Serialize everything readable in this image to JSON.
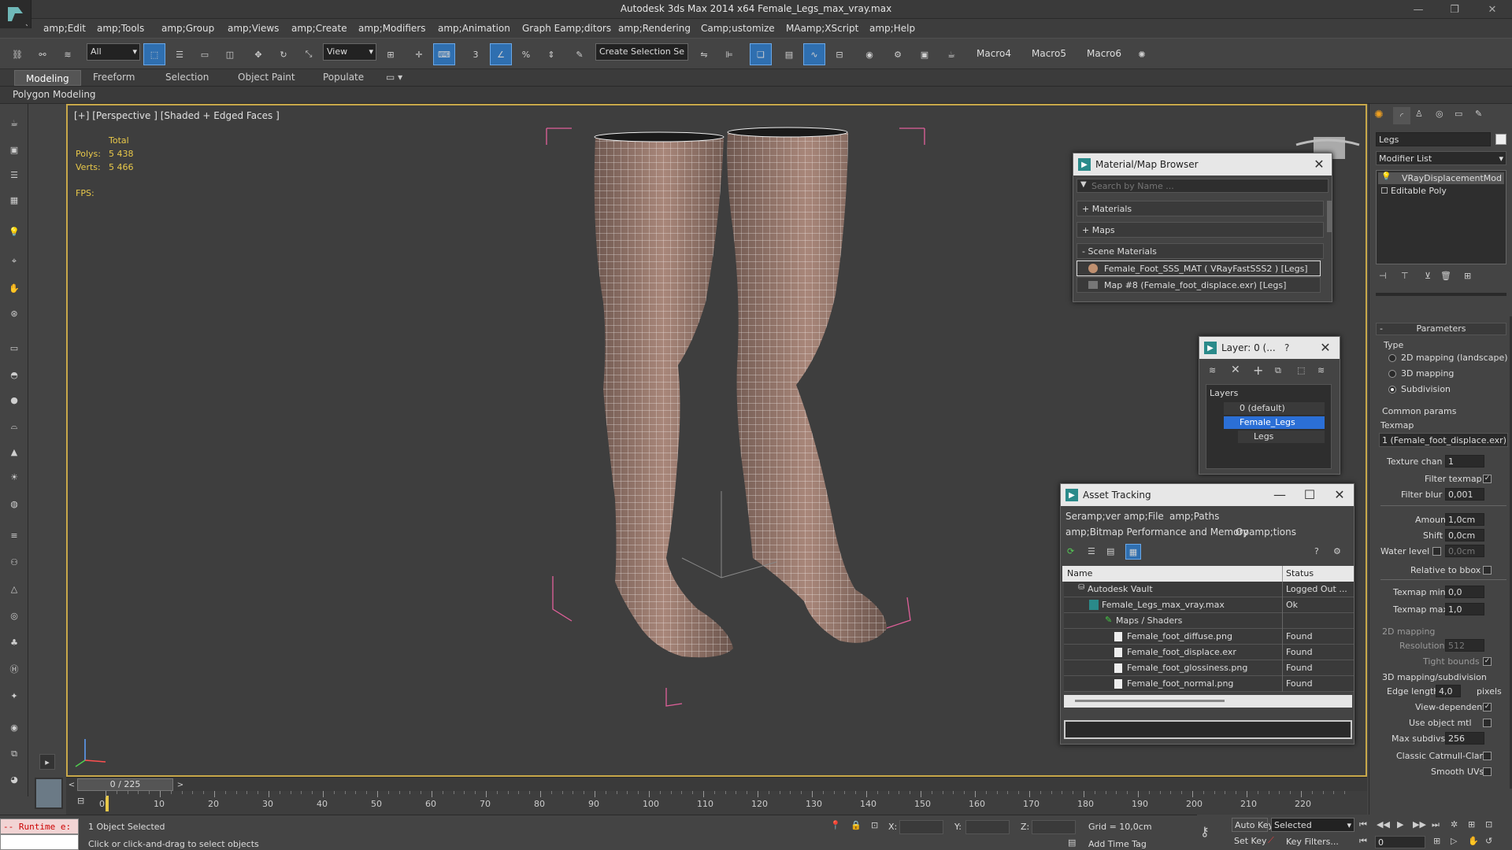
{
  "app": {
    "title": "Autodesk 3ds Max  2014 x64      Female_Legs_max_vray.max"
  },
  "menus": [
    "amp;Edit",
    "amp;Tools",
    "amp;Group",
    "amp;Views",
    "amp;Create",
    "amp;Modifiers",
    "amp;Animation",
    "Graph Eamp;ditors",
    "amp;Rendering",
    "Camp;ustomize",
    "MAamp;XScript",
    "amp;Help"
  ],
  "toolbar": {
    "filter": "All",
    "ref_coord": "View",
    "selection_set": "Create Selection Se",
    "macros": [
      "Macro4",
      "Macro5",
      "Macro6"
    ]
  },
  "ribbon": {
    "tabs": [
      "Modeling",
      "Freeform",
      "Selection",
      "Object Paint",
      "Populate"
    ],
    "panel": "Polygon Modeling"
  },
  "viewport": {
    "label": "[+] [Perspective ] [Shaded + Edged Faces ]",
    "stats": {
      "header": "Total",
      "polys_label": "Polys:",
      "polys": "5 438",
      "verts_label": "Verts:",
      "verts": "5 466",
      "fps_label": "FPS:"
    }
  },
  "material_browser": {
    "title": "Material/Map Browser",
    "search_placeholder": "Search by Name ...",
    "groups": [
      "+ Materials",
      "+ Maps",
      "- Scene Materials"
    ],
    "items": [
      "Female_Foot_SSS_MAT  ( VRayFastSSS2 )  [Legs]",
      "Map #8 (Female_foot_displace.exr) [Legs]"
    ]
  },
  "layer_dialog": {
    "title": "Layer: 0 (...",
    "help": "?",
    "header": "Layers",
    "items": [
      "0 (default)",
      "Female_Legs",
      "Legs"
    ]
  },
  "asset_tracking": {
    "title": "Asset Tracking",
    "menu1": [
      "Seramp;ver",
      "amp;File",
      "amp;Paths"
    ],
    "menu2": [
      "amp;Bitmap Performance and Memory",
      "Opamp;tions"
    ],
    "col_name": "Name",
    "col_status": "Status",
    "rows": [
      {
        "name": "Autodesk Vault",
        "status": "Logged Out ..."
      },
      {
        "name": "Female_Legs_max_vray.max",
        "status": "Ok"
      },
      {
        "name": "Maps / Shaders",
        "status": ""
      },
      {
        "name": "Female_foot_diffuse.png",
        "status": "Found"
      },
      {
        "name": "Female_foot_displace.exr",
        "status": "Found"
      },
      {
        "name": "Female_foot_glossiness.png",
        "status": "Found"
      },
      {
        "name": "Female_foot_normal.png",
        "status": "Found"
      }
    ]
  },
  "command_panel": {
    "object_name": "Legs",
    "modifier_list": "Modifier List",
    "stack": [
      "VRayDisplacementMod",
      "Editable Poly"
    ],
    "rollout": "Parameters",
    "type_label": "Type",
    "types": [
      "2D mapping (landscape)",
      "3D mapping",
      "Subdivision"
    ],
    "common": "Common params",
    "texmap_label": "Texmap",
    "texmap": "1 (Female_foot_displace.exr)",
    "texture_chan_label": "Texture chan",
    "texture_chan": "1",
    "filter_texmap": "Filter texmap",
    "filter_blur_label": "Filter blur",
    "filter_blur": "0,001",
    "amount_label": "Amount",
    "amount": "1,0cm",
    "shift_label": "Shift",
    "shift": "0,0cm",
    "water_label": "Water level",
    "water": "0,0cm",
    "relative": "Relative to bbox",
    "texmap_min_label": "Texmap min",
    "texmap_min": "0,0",
    "texmap_max_label": "Texmap max",
    "texmap_max": "1,0",
    "map2d": "2D mapping",
    "resolution_label": "Resolution",
    "resolution": "512",
    "tight_bounds": "Tight bounds",
    "sub3d": "3D mapping/subdivision",
    "edge_label": "Edge length",
    "edge": "4,0",
    "pixels": "pixels",
    "view_dependent": "View-dependent",
    "use_object_mtl": "Use object mtl",
    "max_subdivs_label": "Max subdivs",
    "max_subdivs": "256",
    "catmull": "Classic Catmull-Clark",
    "smooth_uvs": "Smooth UVs"
  },
  "timeline": {
    "frame": "0 / 225",
    "ticks": [
      "0",
      "10",
      "20",
      "30",
      "40",
      "50",
      "60",
      "70",
      "80",
      "90",
      "100",
      "110",
      "120",
      "130",
      "140",
      "150",
      "160",
      "170",
      "180",
      "190",
      "200",
      "210",
      "220"
    ]
  },
  "status": {
    "runtime": "-- Runtime e:",
    "selected": "1 Object Selected",
    "prompt": "Click or click-and-drag to select objects",
    "x": "X:",
    "y": "Y:",
    "z": "Z:",
    "grid": "Grid = 10,0cm",
    "add_time_tag": "Add Time Tag",
    "auto_key": "Auto Key",
    "set_key": "Set Key",
    "key_mode": "Selected",
    "key_filters": "Key Filters...",
    "frame_val": "0"
  }
}
